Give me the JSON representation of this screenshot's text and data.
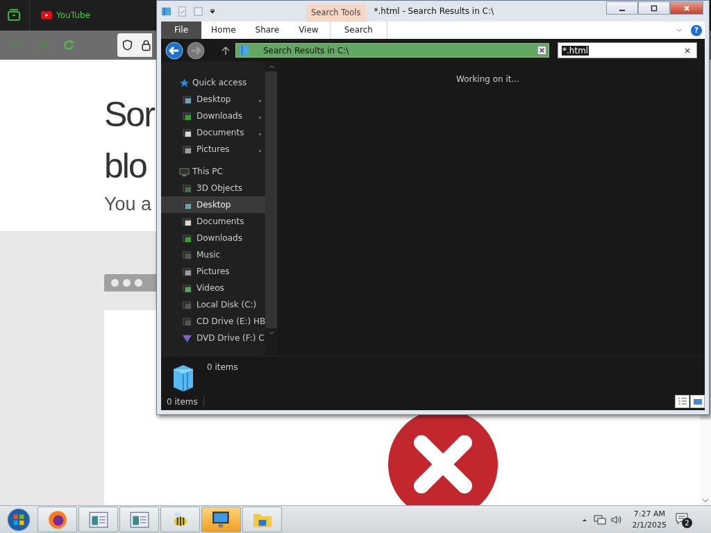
{
  "browser": {
    "tab": {
      "title": "YouTube"
    },
    "page": {
      "heading_lines": [
        "Sor",
        "blo"
      ],
      "subtitle": "You a"
    }
  },
  "explorer": {
    "title": "*.html - Search Results in C:\\",
    "contextual_tab": "Search Tools",
    "ribbon_tabs": [
      {
        "label": "File",
        "kind": "file",
        "selected": false
      },
      {
        "label": "Home",
        "kind": "tab",
        "selected": false
      },
      {
        "label": "Share",
        "kind": "tab",
        "selected": false
      },
      {
        "label": "View",
        "kind": "tab",
        "selected": false
      },
      {
        "label": "Search",
        "kind": "contextual",
        "selected": false
      }
    ],
    "address": "Search Results in C:\\",
    "search": {
      "value": "*.html"
    },
    "nav": [
      {
        "label": "Quick access",
        "kind": "star",
        "selected": false,
        "children": [
          {
            "label": "Desktop",
            "kind": "desktop",
            "selected": false,
            "pinned": true
          },
          {
            "label": "Downloads",
            "kind": "downloads",
            "selected": false,
            "pinned": true
          },
          {
            "label": "Documents",
            "kind": "documents",
            "selected": false,
            "pinned": true
          },
          {
            "label": "Pictures",
            "kind": "pictures",
            "selected": false,
            "pinned": true
          }
        ]
      },
      {
        "label": "This PC",
        "kind": "pc",
        "selected": false,
        "children": [
          {
            "label": "3D Objects",
            "kind": "objects",
            "selected": false,
            "pinned": false
          },
          {
            "label": "Desktop",
            "kind": "desktop",
            "selected": true,
            "pinned": false
          },
          {
            "label": "Documents",
            "kind": "documents",
            "selected": false,
            "pinned": false
          },
          {
            "label": "Downloads",
            "kind": "downloads",
            "selected": false,
            "pinned": false
          },
          {
            "label": "Music",
            "kind": "music",
            "selected": false,
            "pinned": false
          },
          {
            "label": "Pictures",
            "kind": "pictures",
            "selected": false,
            "pinned": false
          },
          {
            "label": "Videos",
            "kind": "videos",
            "selected": false,
            "pinned": false
          },
          {
            "label": "Local Disk (C:)",
            "kind": "disk",
            "selected": false,
            "pinned": false
          },
          {
            "label": "CD Drive (E:) HB",
            "kind": "disk",
            "selected": false,
            "pinned": false
          },
          {
            "label": "DVD Drive (F:) C",
            "kind": "dvd",
            "selected": false,
            "pinned": false
          }
        ]
      }
    ],
    "help_button": "?",
    "status_message": "Working on it...",
    "details": {
      "count": "0 items"
    },
    "status_bar": {
      "count": "0 items"
    }
  },
  "taskbar": {
    "buttons": [
      {
        "kind": "firefox",
        "active": false
      },
      {
        "kind": "window",
        "active": false
      },
      {
        "kind": "window",
        "active": false
      },
      {
        "kind": "bee",
        "active": false
      },
      {
        "kind": "monitor",
        "active": true
      },
      {
        "kind": "folder",
        "active": false
      }
    ],
    "time": "7:27 AM",
    "date": "2/1/2025",
    "notifications": "2"
  }
}
